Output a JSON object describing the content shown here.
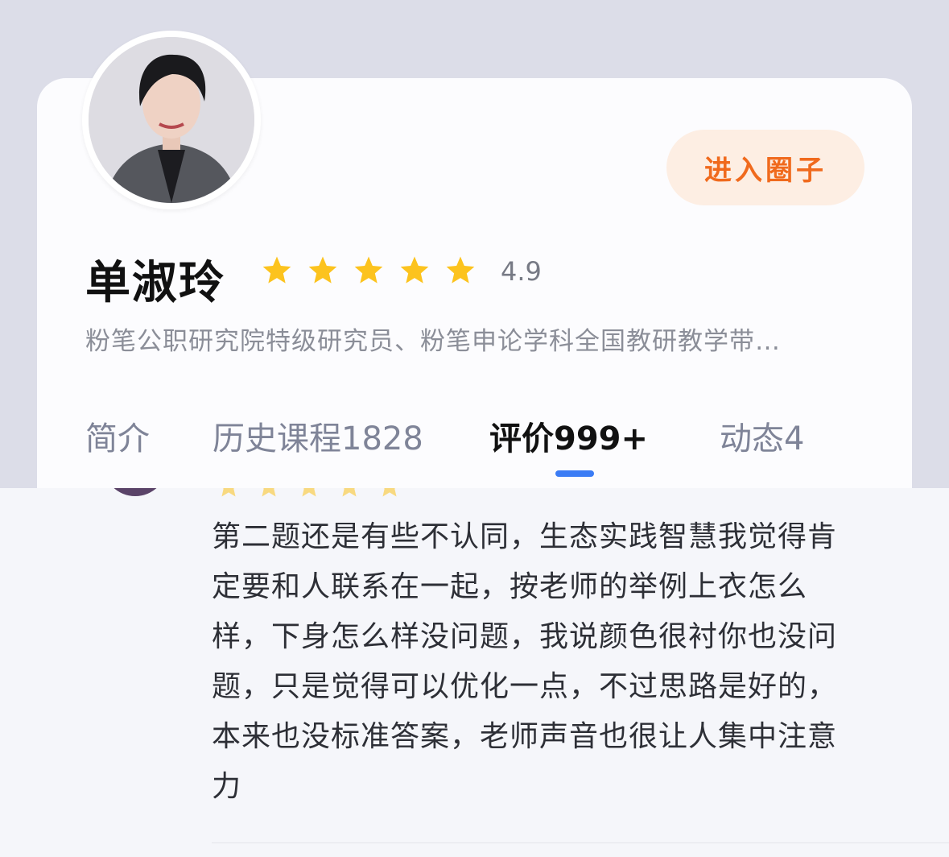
{
  "teacher": {
    "name": "单淑玲",
    "rating": "4.9",
    "star_count": 5,
    "description": "粉笔公职研究院特级研究员、粉笔申论学科全国教研教学带…",
    "join_button": "进入圈子"
  },
  "tabs": [
    {
      "label": "简介"
    },
    {
      "label": "历史课程1828"
    },
    {
      "label": "评价999+",
      "active": true
    },
    {
      "label": "动态4"
    }
  ],
  "review": {
    "text": "第二题还是有些不认同，生态实践智慧我觉得肯定要和人联系在一起，按老师的举例上衣怎么样，下身怎么样没问题，我说颜色很衬你也没问题，只是觉得可以优化一点，不过思路是好的，本来也没标准答案，老师声音也很让人集中注意力"
  },
  "colors": {
    "accent_orange": "#f06a1d",
    "star_yellow": "#fcc31e",
    "tab_underline": "#3b7cf5"
  }
}
